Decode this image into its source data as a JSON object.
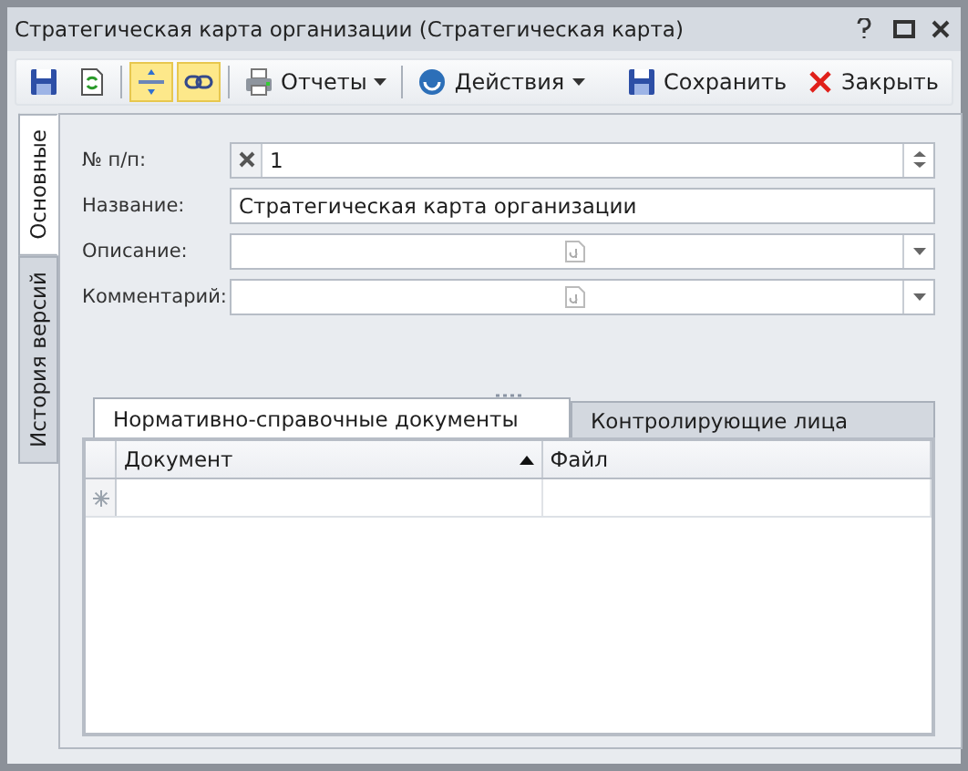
{
  "window": {
    "title": "Стратегическая карта организации (Стратегическая карта)"
  },
  "toolbar": {
    "left": [
      {
        "kind": "icon"
      },
      {
        "kind": "icon"
      },
      {
        "kind": "separator"
      },
      {
        "kind": "toggle",
        "checked": true
      },
      {
        "kind": "toggle",
        "checked": true
      },
      {
        "kind": "separator"
      },
      {
        "kind": "menu",
        "label": "Отчеты"
      },
      {
        "kind": "separator"
      },
      {
        "kind": "menu",
        "label": "Действия"
      }
    ],
    "right": [
      {
        "label": "Сохранить"
      },
      {
        "label": "Закрыть"
      }
    ]
  },
  "side_tabs": [
    {
      "label": "Основные",
      "selected": true
    },
    {
      "label": "История версий",
      "selected": false
    }
  ],
  "fields": [
    {
      "kind": "number",
      "label": "№ п/п:",
      "value": "1"
    },
    {
      "kind": "text",
      "label": "Название:",
      "value": "Стратегическая карта организации"
    },
    {
      "kind": "memo",
      "label": "Описание:"
    },
    {
      "kind": "memo",
      "label": "Комментарий:"
    }
  ],
  "detail_tabs": [
    {
      "label": "Нормативно-справочные документы",
      "selected": true
    },
    {
      "label": "Контролирующие лица",
      "selected": false
    }
  ],
  "grid": {
    "columns": [
      {
        "label": "Документ",
        "sorted": true
      },
      {
        "label": "Файл",
        "sorted": false
      }
    ],
    "new_row": true
  }
}
